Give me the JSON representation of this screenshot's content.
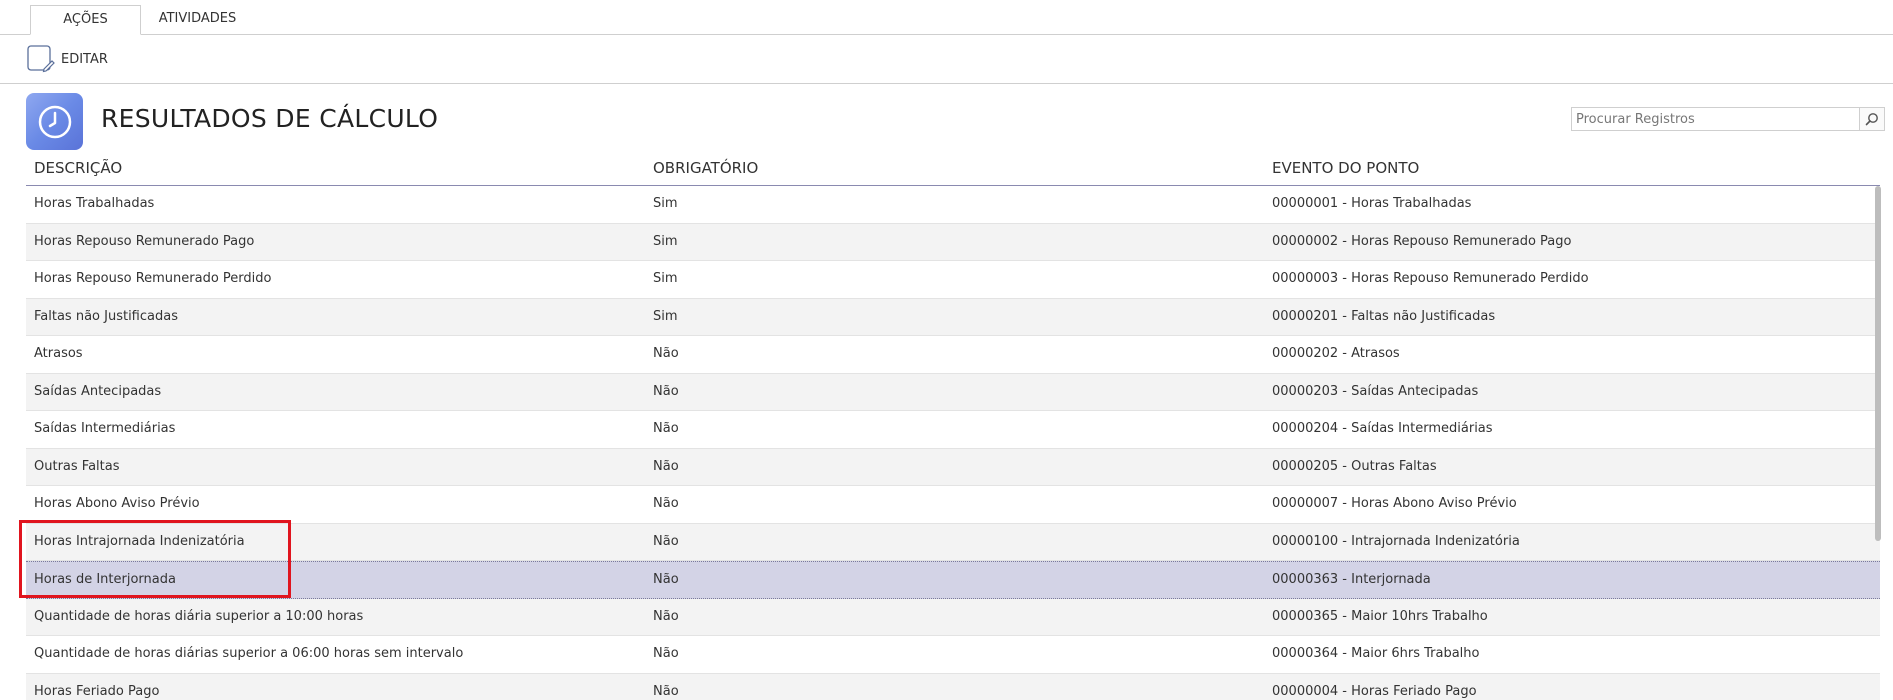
{
  "tabs": [
    {
      "label": "AÇÕES",
      "active": true
    },
    {
      "label": "ATIVIDADES",
      "active": false
    }
  ],
  "toolbar": {
    "edit_label": "EDITAR",
    "edit_icon": "edit-icon"
  },
  "header": {
    "title": "RESULTADOS DE CÁLCULO",
    "icon": "clock-icon"
  },
  "search": {
    "placeholder": "Procurar Registros",
    "value": "",
    "icon": "search-icon"
  },
  "table": {
    "columns": [
      "DESCRIÇÃO",
      "OBRIGATÓRIO",
      "EVENTO DO PONTO"
    ],
    "rows": [
      {
        "descricao": "Horas Trabalhadas",
        "obrigatorio": "Sim",
        "evento": "00000001 - Horas Trabalhadas"
      },
      {
        "descricao": "Horas Repouso Remunerado Pago",
        "obrigatorio": "Sim",
        "evento": "00000002 - Horas Repouso Remunerado Pago"
      },
      {
        "descricao": "Horas Repouso Remunerado Perdido",
        "obrigatorio": "Sim",
        "evento": "00000003 - Horas Repouso Remunerado Perdido"
      },
      {
        "descricao": "Faltas não Justificadas",
        "obrigatorio": "Sim",
        "evento": "00000201 - Faltas não Justificadas"
      },
      {
        "descricao": "Atrasos",
        "obrigatorio": "Não",
        "evento": "00000202 - Atrasos"
      },
      {
        "descricao": "Saídas Antecipadas",
        "obrigatorio": "Não",
        "evento": "00000203 - Saídas Antecipadas"
      },
      {
        "descricao": "Saídas Intermediárias",
        "obrigatorio": "Não",
        "evento": "00000204 - Saídas Intermediárias"
      },
      {
        "descricao": "Outras Faltas",
        "obrigatorio": "Não",
        "evento": "00000205 - Outras Faltas"
      },
      {
        "descricao": "Horas Abono Aviso Prévio",
        "obrigatorio": "Não",
        "evento": "00000007 - Horas Abono Aviso Prévio"
      },
      {
        "descricao": "Horas Intrajornada Indenizatória",
        "obrigatorio": "Não",
        "evento": "00000100 - Intrajornada Indenizatória"
      },
      {
        "descricao": "Horas de Interjornada",
        "obrigatorio": "Não",
        "evento": "00000363 - Interjornada",
        "selected": true
      },
      {
        "descricao": "Quantidade de horas diária superior a 10:00 horas",
        "obrigatorio": "Não",
        "evento": "00000365 - Maior 10hrs Trabalho"
      },
      {
        "descricao": "Quantidade de horas diárias superior a 06:00 horas sem intervalo",
        "obrigatorio": "Não",
        "evento": "00000364 - Maior 6hrs Trabalho"
      },
      {
        "descricao": "Horas Feriado Pago",
        "obrigatorio": "Não",
        "evento": "00000004 - Horas Feriado Pago"
      }
    ]
  },
  "colors": {
    "accent_icon": "#6a8ae6",
    "selected_row": "#d3d3e6",
    "highlight_border": "#e0141e",
    "header_underline": "#8a8ab0"
  }
}
